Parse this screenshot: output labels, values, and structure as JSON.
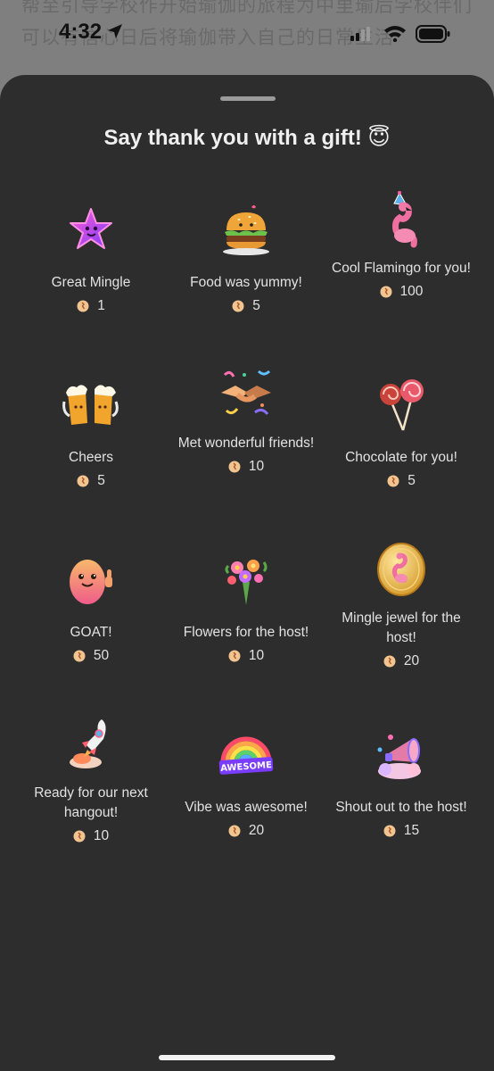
{
  "background": {
    "text": "帮至引导学校作开始瑜伽的旅程为中里瑜后学校伴们可以有信心日后将瑜伽带入自己的日常生活"
  },
  "status_bar": {
    "time": "4:32"
  },
  "sheet": {
    "title": "Say thank you with a gift! 😇",
    "gifts": [
      {
        "label": "Great Mingle",
        "price": "1",
        "icon": "star-icon"
      },
      {
        "label": "Food was yummy!",
        "price": "5",
        "icon": "burger-icon"
      },
      {
        "label": "Cool Flamingo for you!",
        "price": "100",
        "icon": "flamingo-icon"
      },
      {
        "label": "Cheers",
        "price": "5",
        "icon": "beer-mugs-icon"
      },
      {
        "label": "Met wonderful friends!",
        "price": "10",
        "icon": "handshake-icon"
      },
      {
        "label": "Chocolate for you!",
        "price": "5",
        "icon": "lollipop-icon"
      },
      {
        "label": "GOAT!",
        "price": "50",
        "icon": "potato-thumbs-up-icon"
      },
      {
        "label": "Flowers for the host!",
        "price": "10",
        "icon": "bouquet-icon"
      },
      {
        "label": "Mingle jewel for the host!",
        "price": "20",
        "icon": "flamingo-coin-icon"
      },
      {
        "label": "Ready for our next hangout!",
        "price": "10",
        "icon": "rocket-icon"
      },
      {
        "label": "Vibe was awesome!",
        "price": "20",
        "icon": "rainbow-awesome-icon"
      },
      {
        "label": "Shout out to the host!",
        "price": "15",
        "icon": "megaphone-icon"
      }
    ],
    "awesome_badge_text": "AWESOME"
  },
  "colors": {
    "sheet_bg": "#2d2d2d",
    "text": "#e2e2e2",
    "coin": "#f2c48f"
  }
}
